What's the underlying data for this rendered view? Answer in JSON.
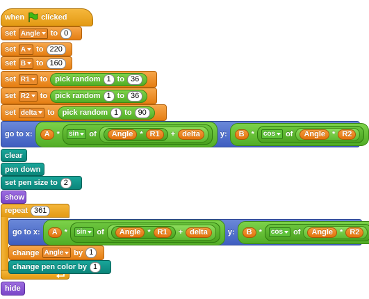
{
  "hat": {
    "when": "when",
    "clicked": "clicked"
  },
  "setters": [
    {
      "set": "set",
      "var": "Angle",
      "to": "to",
      "value": "0"
    },
    {
      "set": "set",
      "var": "A",
      "to": "to",
      "value": "220"
    },
    {
      "set": "set",
      "var": "B",
      "to": "to",
      "value": "160"
    },
    {
      "set": "set",
      "var": "R1",
      "to": "to",
      "pick": "pick random",
      "from": "1",
      "to2": "to",
      "max": "36"
    },
    {
      "set": "set",
      "var": "R2",
      "to": "to",
      "pick": "pick random",
      "from": "1",
      "to2": "to",
      "max": "36"
    },
    {
      "set": "set",
      "var": "delta",
      "to": "to",
      "pick": "pick random",
      "from": "1",
      "to2": "to",
      "max": "90"
    }
  ],
  "goto": {
    "label": "go to x:",
    "a": "A",
    "times": "*",
    "sin": "sin",
    "of": "of",
    "angle": "Angle",
    "r1": "R1",
    "plus": "+",
    "delta": "delta",
    "y": "y:",
    "b": "B",
    "cos": "cos",
    "r2": "R2"
  },
  "pen": {
    "clear": "clear",
    "pen_down": "pen down",
    "set_size": "set pen size to",
    "size": "2",
    "show": "show"
  },
  "loop": {
    "repeat": "repeat",
    "count": "361",
    "change": "change",
    "var": "Angle",
    "by": "by",
    "by_value": "1",
    "change_color": "change pen color by",
    "color_value": "1"
  },
  "hide": "hide"
}
